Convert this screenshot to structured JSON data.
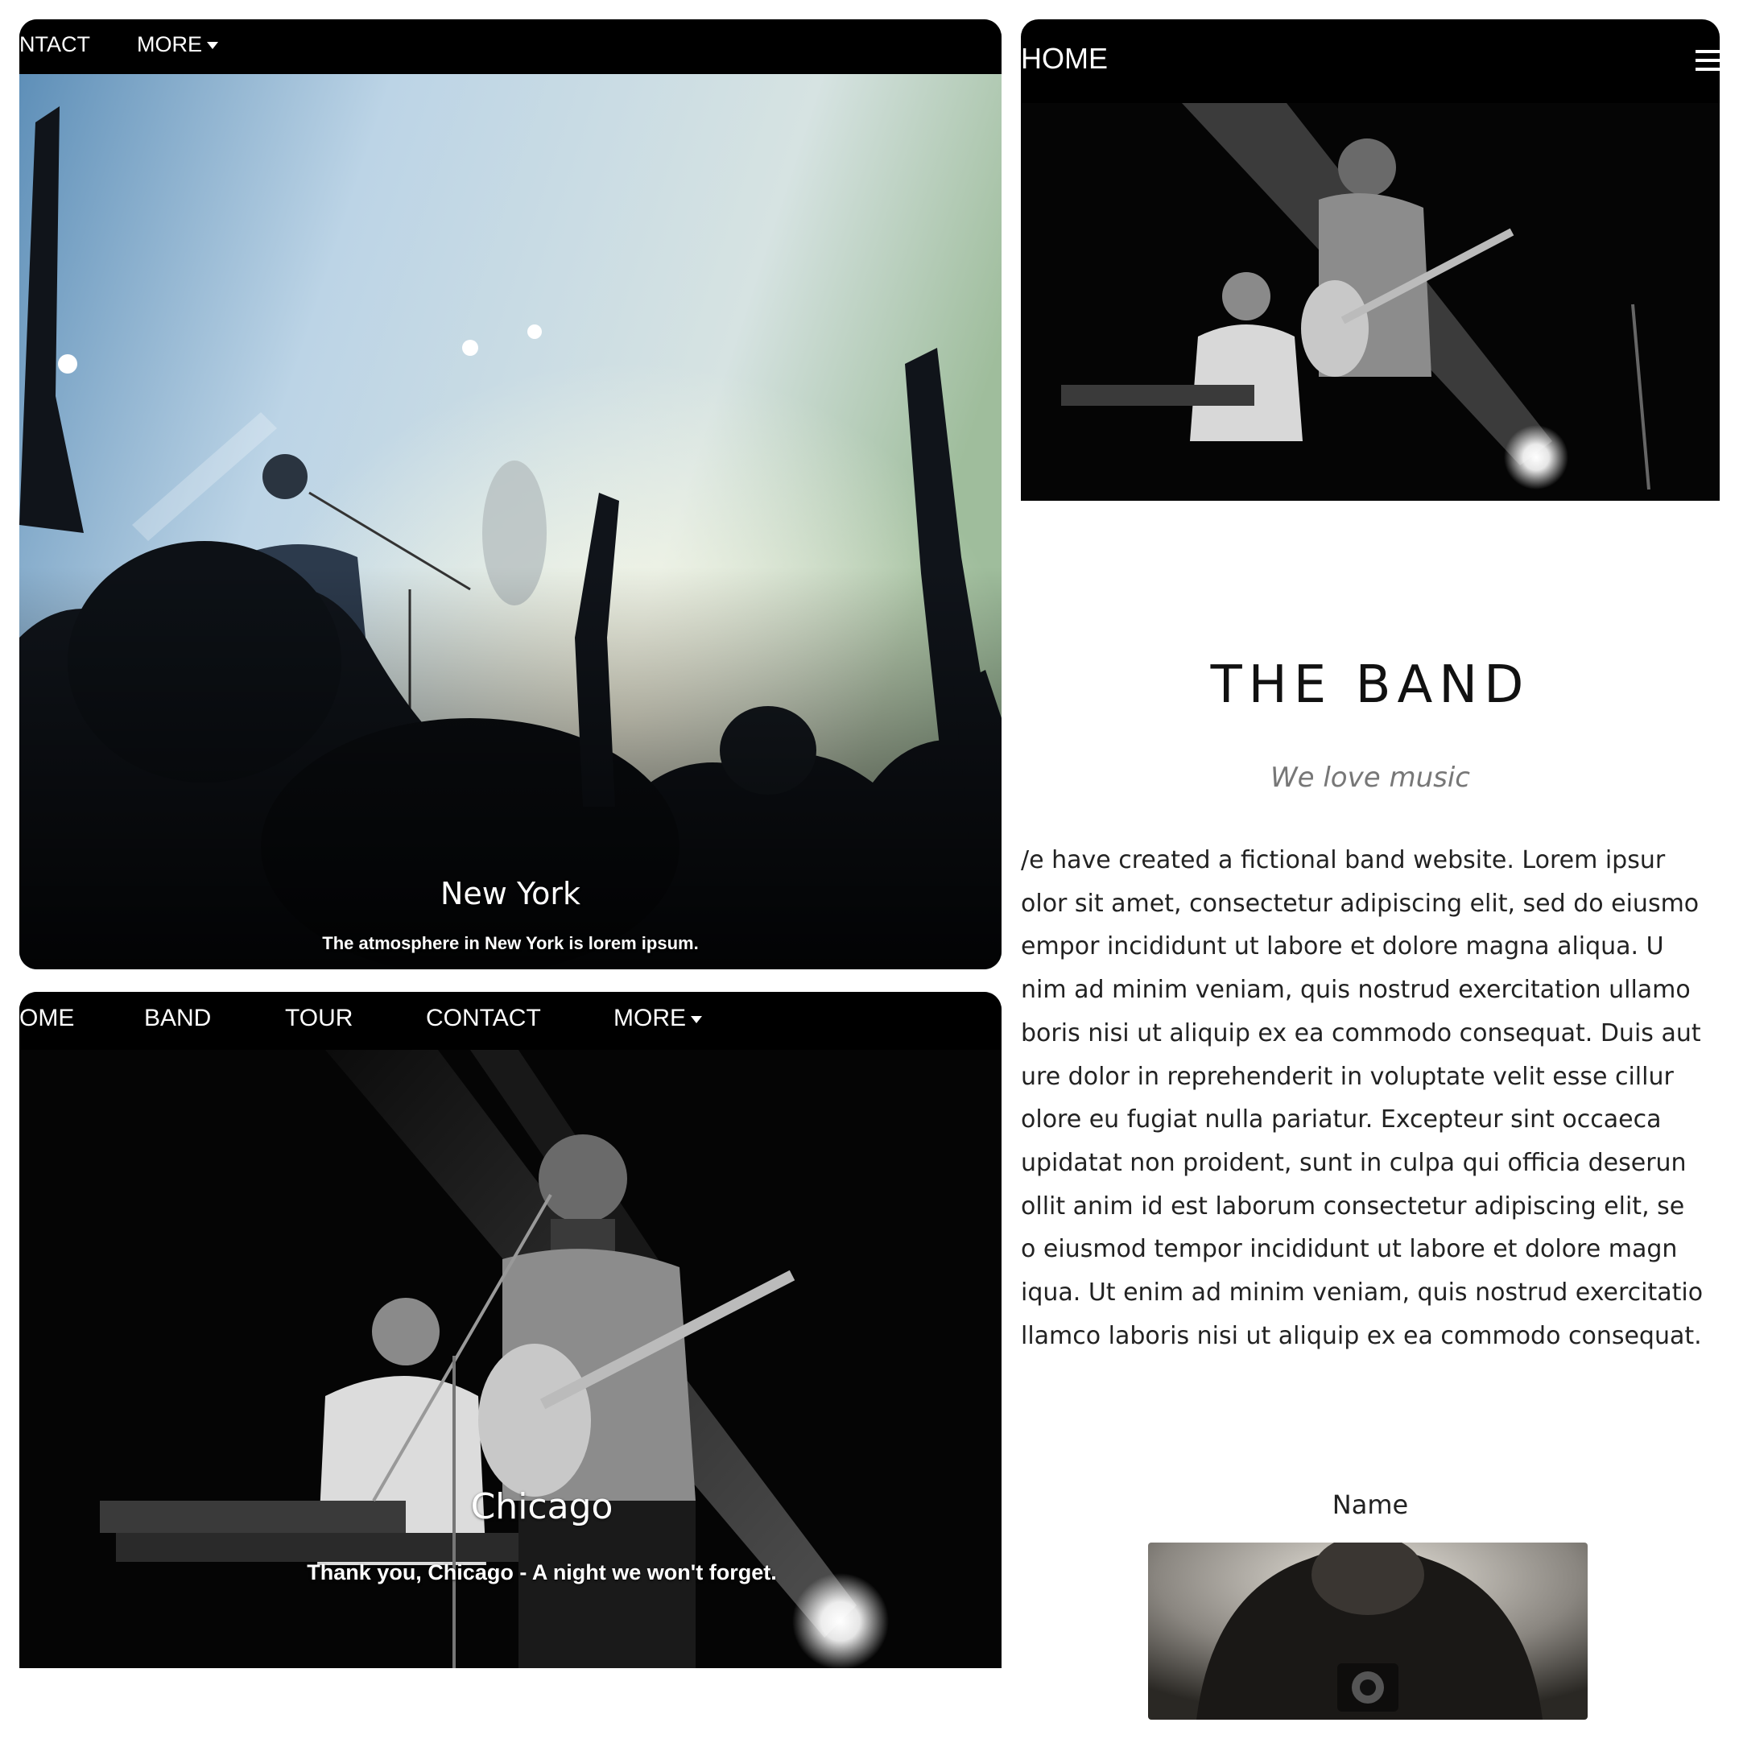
{
  "panel_new_york": {
    "nav": {
      "contact": "NTACT",
      "more": "MORE"
    },
    "caption_title": "New York",
    "caption_text": "The atmosphere in New York is lorem ipsum."
  },
  "panel_chicago": {
    "nav": {
      "home": "OME",
      "band": "BAND",
      "tour": "TOUR",
      "contact": "CONTACT",
      "more": "MORE"
    },
    "caption_title": "Chicago",
    "caption_text": "Thank you, Chicago - A night we won't forget."
  },
  "panel_mobile": {
    "nav": {
      "home": "HOME"
    },
    "band_title": "THE BAND",
    "tagline": "We love music",
    "body_lines": [
      "/e have created a fictional band website. Lorem ipsur",
      "olor sit amet, consectetur adipiscing elit, sed do eiusmo",
      "empor incididunt ut labore et dolore magna aliqua. U",
      "nim ad minim veniam, quis nostrud exercitation ullamo",
      "boris nisi ut aliquip ex ea commodo consequat. Duis aut",
      "ure dolor in reprehenderit in voluptate velit esse cillur",
      "olore eu fugiat nulla pariatur. Excepteur sint occaeca",
      "upidatat non proident, sunt in culpa qui officia deserun",
      "ollit anim id est laborum consectetur adipiscing elit, se",
      "o eiusmod tempor incididunt ut labore et dolore magn",
      "iqua. Ut enim ad minim veniam, quis nostrud exercitatio",
      "llamco laboris nisi ut aliquip ex ea commodo consequat."
    ],
    "member_name": "Name"
  }
}
